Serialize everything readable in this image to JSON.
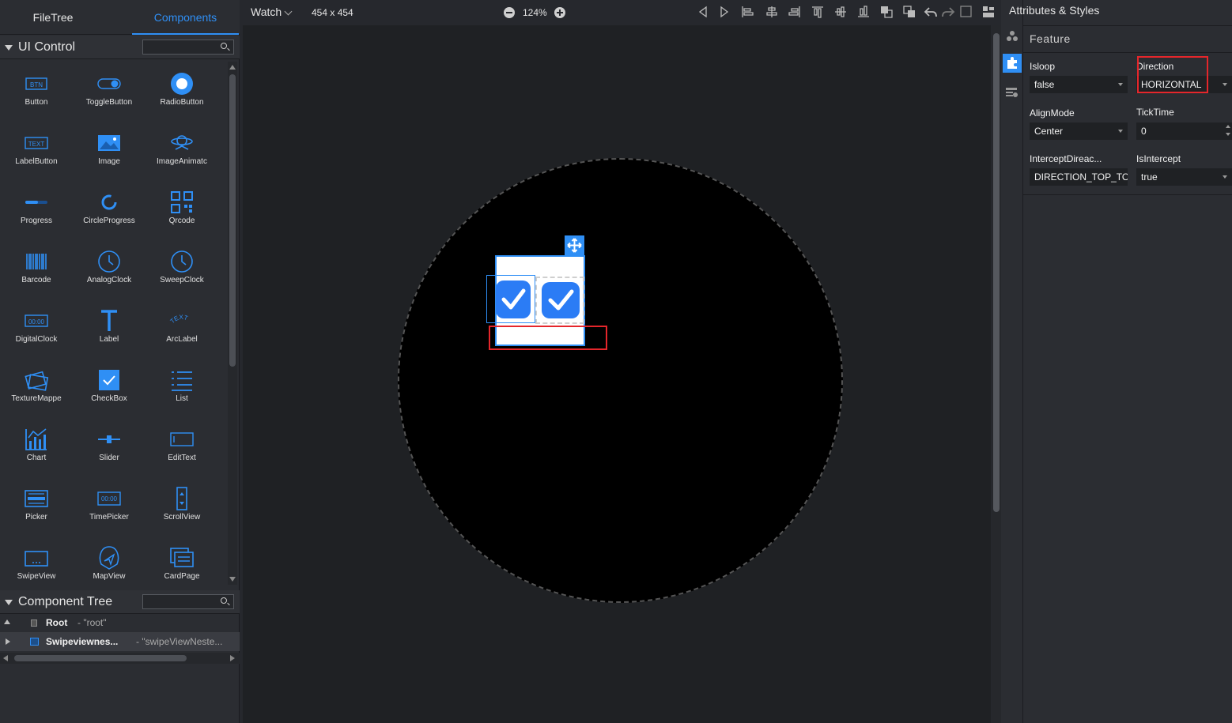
{
  "left_panel": {
    "tabs": [
      "FileTree",
      "Components"
    ],
    "ui_control": {
      "title": "UI Control",
      "search_value": ""
    },
    "palette": [
      {
        "label": "Button",
        "icon": "btn-icon"
      },
      {
        "label": "ToggleButton",
        "icon": "toggle-icon"
      },
      {
        "label": "RadioButton",
        "icon": "radio-icon"
      },
      {
        "label": "LabelButton",
        "icon": "text-icon"
      },
      {
        "label": "Image",
        "icon": "image-icon"
      },
      {
        "label": "ImageAnimatc",
        "icon": "image-animator-icon"
      },
      {
        "label": "Progress",
        "icon": "progress-icon"
      },
      {
        "label": "CircleProgress",
        "icon": "circle-progress-icon"
      },
      {
        "label": "Qrcode",
        "icon": "qrcode-icon"
      },
      {
        "label": "Barcode",
        "icon": "barcode-icon"
      },
      {
        "label": "AnalogClock",
        "icon": "clock-icon"
      },
      {
        "label": "SweepClock",
        "icon": "clock-icon"
      },
      {
        "label": "DigitalClock",
        "icon": "digital-clock-icon"
      },
      {
        "label": "Label",
        "icon": "label-icon"
      },
      {
        "label": "ArcLabel",
        "icon": "arc-label-icon"
      },
      {
        "label": "TextureMappe",
        "icon": "texture-icon"
      },
      {
        "label": "CheckBox",
        "icon": "checkbox-icon"
      },
      {
        "label": "List",
        "icon": "list-icon"
      },
      {
        "label": "Chart",
        "icon": "chart-icon"
      },
      {
        "label": "Slider",
        "icon": "slider-icon"
      },
      {
        "label": "EditText",
        "icon": "edittext-icon"
      },
      {
        "label": "Picker",
        "icon": "picker-icon"
      },
      {
        "label": "TimePicker",
        "icon": "timepicker-icon"
      },
      {
        "label": "ScrollView",
        "icon": "scrollview-icon"
      },
      {
        "label": "SwipeView",
        "icon": "swipeview-icon"
      },
      {
        "label": "MapView",
        "icon": "mapview-icon"
      },
      {
        "label": "CardPage",
        "icon": "cardpage-icon"
      }
    ],
    "icon_texts": {
      "btn": "BTN",
      "text": "TEXT",
      "digital": "00:00",
      "timepicker": "00:00",
      "arc": "TEXT"
    },
    "component_tree": {
      "title": "Component Tree",
      "search_value": "",
      "rows": [
        {
          "name": "Root",
          "id": "- \"root\""
        },
        {
          "name": "Swipeviewnes...",
          "id": "- \"swipeViewNeste..."
        }
      ]
    }
  },
  "toolbar": {
    "device": "Watch",
    "resolution": "454 x 454",
    "zoom": "124%",
    "icons": [
      "prev-icon",
      "next-icon",
      "align-left-icon",
      "align-center-icon",
      "align-right-icon",
      "align-top-icon",
      "align-middle-icon",
      "align-bottom-icon",
      "bring-front-icon",
      "send-back-icon",
      "undo-icon",
      "redo-icon",
      "checkbox-empty-icon",
      "layout-icon"
    ]
  },
  "right_panel": {
    "title": "Attributes & Styles",
    "section": "Feature",
    "fields": [
      {
        "label": "Isloop",
        "value": "false",
        "kind": "select"
      },
      {
        "label": "Direction",
        "value": "HORIZONTAL",
        "kind": "select"
      },
      {
        "label": "AlignMode",
        "value": "Center",
        "kind": "select"
      },
      {
        "label": "TickTime",
        "value": "0",
        "kind": "number"
      },
      {
        "label": "InterceptDireac...",
        "value": "DIRECTION_TOP_TO",
        "kind": "text"
      },
      {
        "label": "IsIntercept",
        "value": "true",
        "kind": "select"
      }
    ]
  },
  "colors": {
    "accent": "#2f8ff5",
    "highlight": "#e5262b",
    "panel": "#2b2d32",
    "canvas": "#1f2124"
  }
}
